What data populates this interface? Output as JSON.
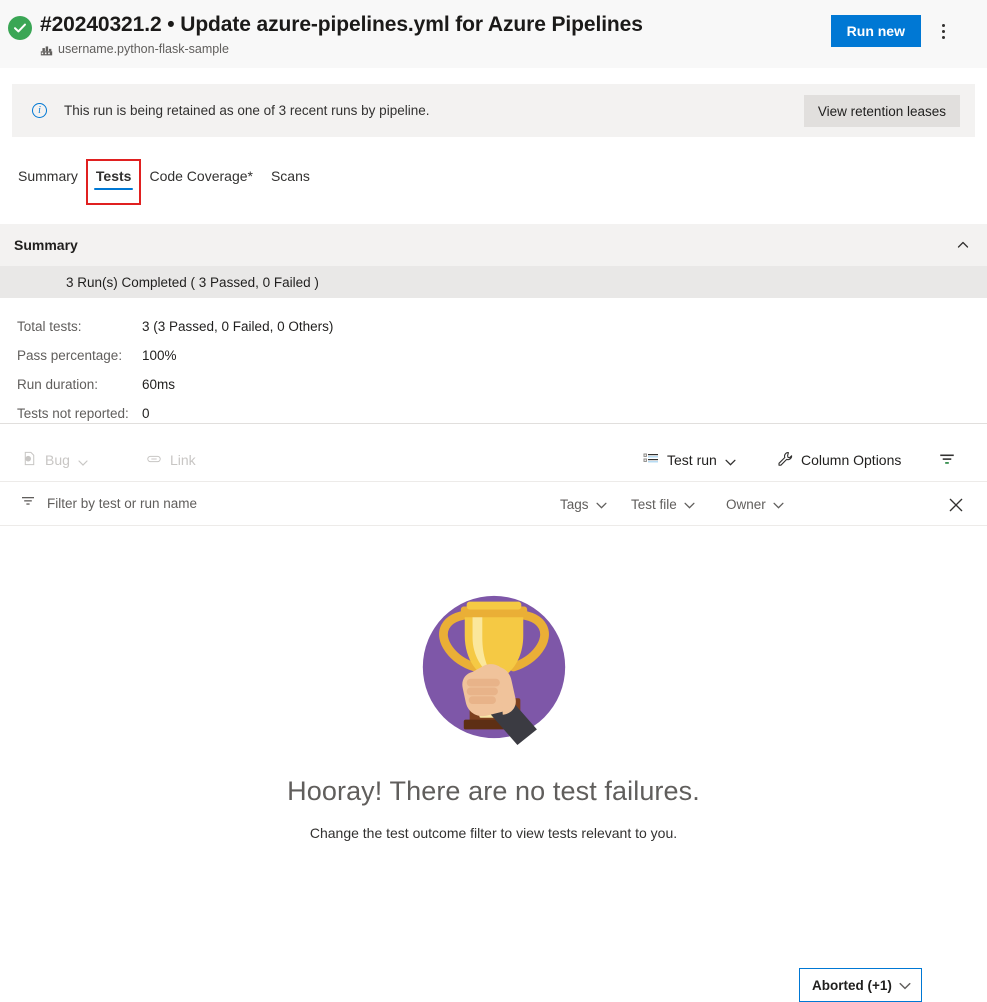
{
  "header": {
    "status_icon": "success-check-icon",
    "title": "#20240321.2 • Update azure-pipelines.yml for Azure Pipelines",
    "pipeline_icon": "pipeline-icon",
    "subtitle": "username.python-flask-sample",
    "run_new_label": "Run new",
    "more_actions_icon": "more-vertical-icon"
  },
  "banner": {
    "info_icon": "info-circle-icon",
    "glyph": "i",
    "message": "This run is being retained as one of 3 recent runs by pipeline.",
    "action_label": "View retention leases"
  },
  "tabs": [
    {
      "label": "Summary",
      "selected": false,
      "highlighted": false
    },
    {
      "label": "Tests",
      "selected": true,
      "highlighted": true
    },
    {
      "label": "Code Coverage*",
      "selected": false,
      "highlighted": false
    },
    {
      "label": "Scans",
      "selected": false,
      "highlighted": false
    }
  ],
  "summary": {
    "section_title": "Summary",
    "collapse_icon": "chevron-up-icon",
    "run_line": "3 Run(s) Completed ( 3 Passed, 0 Failed )",
    "stats": [
      {
        "label": "Total tests:",
        "value": "3 (3 Passed, 0 Failed, 0 Others)"
      },
      {
        "label": "Pass percentage:",
        "value": "100%"
      },
      {
        "label": "Run duration:",
        "value": "60ms"
      },
      {
        "label": "Tests not reported:",
        "value": "0"
      }
    ]
  },
  "toolbar": {
    "bug_label": "Bug",
    "bug_icon": "bug-file-icon",
    "bug_chevron": "chevron-down-icon",
    "link_label": "Link",
    "link_icon": "link-icon",
    "test_run_label": "Test run",
    "test_run_icon": "group-list-icon",
    "test_run_chevron": "chevron-down-icon",
    "column_options_label": "Column Options",
    "column_options_icon": "wrench-icon",
    "filter_toggle_icon": "filter-icon"
  },
  "filterbar": {
    "filter_icon": "filter-icon",
    "filter_placeholder": "Filter by test or run name",
    "filter_value": "",
    "tags_label": "Tags",
    "test_file_label": "Test file",
    "owner_label": "Owner",
    "outcome_label": "Aborted (+1)",
    "chevron_icon": "chevron-down-icon",
    "clear_icon": "close-icon"
  },
  "empty_state": {
    "illustration": "trophy-in-hand-icon",
    "title": "Hooray! There are no test failures.",
    "subtitle": "Change the test outcome filter to view tests relevant to you."
  },
  "colors": {
    "accent": "#0078d4",
    "success": "#3aa655",
    "highlight_box": "#e02020",
    "header_bg": "#f8f8f8",
    "banner_bg": "#f3f2f1",
    "trophy_circle": "#7e57a8",
    "trophy_gold": "#f5c944"
  }
}
